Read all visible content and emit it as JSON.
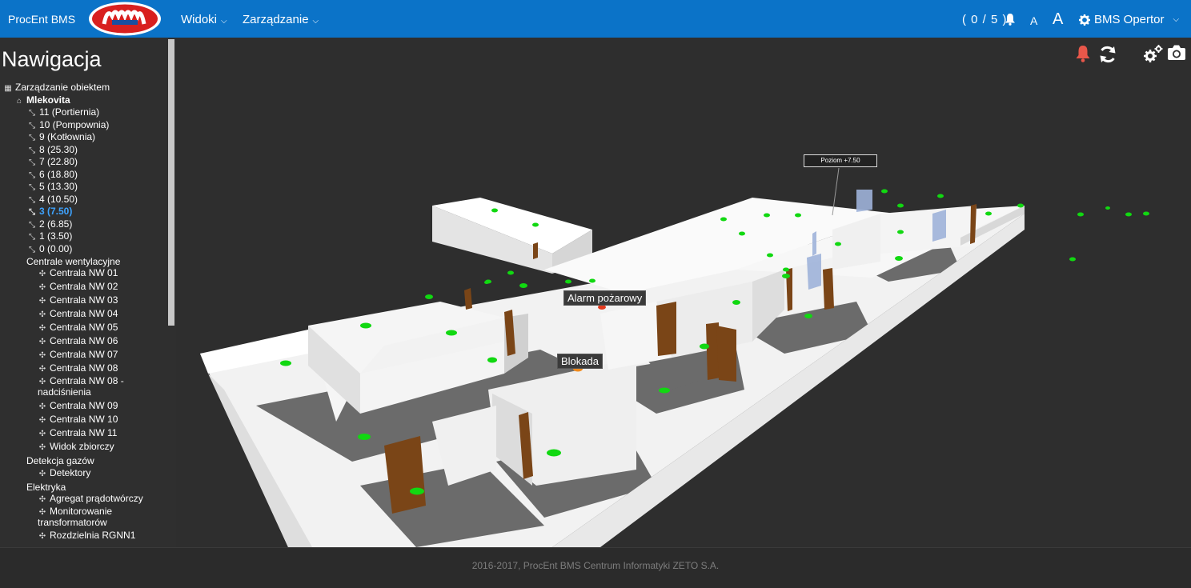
{
  "topbar": {
    "brand": "ProcEnt BMS",
    "menus": [
      {
        "label": "Widoki"
      },
      {
        "label": "Zarządzanie"
      }
    ],
    "alarm_count": "( 0 / 5 )",
    "font_small": "A",
    "font_large": "A",
    "user": "BMS Opertor",
    "color": "#0b73c8"
  },
  "sidebar": {
    "title": "Nawigacja",
    "tree": [
      {
        "label": "Zarządzanie obiektem",
        "icon": "building-icon"
      },
      {
        "label": "Mlekovita",
        "icon": "factory-icon"
      },
      {
        "label": "11 (Portiernia)",
        "icon": "stairs-icon"
      },
      {
        "label": "10 (Pompownia)",
        "icon": "stairs-icon"
      },
      {
        "label": "9 (Kotłownia)",
        "icon": "stairs-icon"
      },
      {
        "label": "8 (25.30)",
        "icon": "stairs-icon"
      },
      {
        "label": "7 (22.80)",
        "icon": "stairs-icon"
      },
      {
        "label": "6 (18.80)",
        "icon": "stairs-icon"
      },
      {
        "label": "5 (13.30)",
        "icon": "stairs-icon"
      },
      {
        "label": "4 (10.50)",
        "icon": "stairs-icon"
      },
      {
        "label": "3 (7.50)",
        "icon": "stairs-icon",
        "active": true
      },
      {
        "label": "2 (6.85)",
        "icon": "stairs-icon"
      },
      {
        "label": "1 (3.50)",
        "icon": "stairs-icon"
      },
      {
        "label": "0 (0.00)",
        "icon": "stairs-icon"
      },
      {
        "label": "Centrale wentylacyjne",
        "icon": ""
      },
      {
        "label": "Centrala NW 01",
        "icon": "fan-icon"
      },
      {
        "label": "Centrala NW 02",
        "icon": "fan-icon"
      },
      {
        "label": "Centrala NW 03",
        "icon": "fan-icon"
      },
      {
        "label": "Centrala NW 04",
        "icon": "fan-icon"
      },
      {
        "label": "Centrala NW 05",
        "icon": "fan-icon"
      },
      {
        "label": "Centrala NW 06",
        "icon": "fan-icon"
      },
      {
        "label": "Centrala NW 07",
        "icon": "fan-icon"
      },
      {
        "label": "Centrala NW 08",
        "icon": "fan-icon"
      },
      {
        "label": "Centrala NW 08 - nadciśnienia",
        "icon": "fan-icon"
      },
      {
        "label": "Centrala NW 09",
        "icon": "fan-icon"
      },
      {
        "label": "Centrala NW 10",
        "icon": "fan-icon"
      },
      {
        "label": "Centrala NW 11",
        "icon": "fan-icon"
      },
      {
        "label": "Widok zbiorczy",
        "icon": "fan-icon"
      },
      {
        "label": "Detekcja gazów",
        "icon": ""
      },
      {
        "label": "Detektory",
        "icon": "fan-icon"
      },
      {
        "label": "Elektryka",
        "icon": ""
      },
      {
        "label": "Agregat prądotwórczy",
        "icon": "fan-icon"
      },
      {
        "label": "Monitorowanie transformatorów",
        "icon": "fan-icon"
      },
      {
        "label": "Rozdzielnia RGNN1",
        "icon": "fan-icon"
      }
    ]
  },
  "view": {
    "level_label": "Poziom +7.50",
    "alarm_label": "Alarm pożarowy",
    "block_label": "Blokada",
    "tools": [
      "alarm-bell-icon",
      "refresh-icon",
      "settings-icon",
      "camera-icon"
    ],
    "alarm_color": "#e8574a"
  },
  "footer": {
    "text": "2016-2017, ProcEnt BMS Centrum Informatyki ZETO S.A."
  }
}
